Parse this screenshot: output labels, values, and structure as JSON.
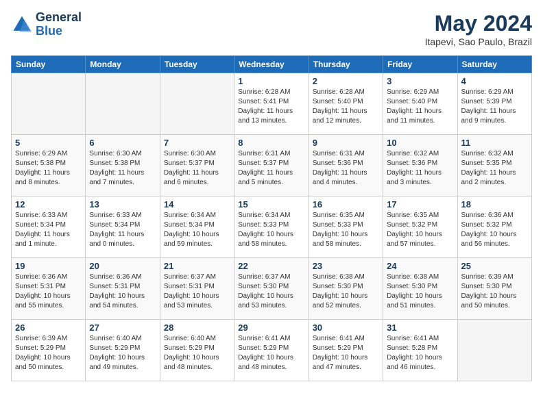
{
  "header": {
    "logo_line1": "General",
    "logo_line2": "Blue",
    "month": "May 2024",
    "location": "Itapevi, Sao Paulo, Brazil"
  },
  "days_of_week": [
    "Sunday",
    "Monday",
    "Tuesday",
    "Wednesday",
    "Thursday",
    "Friday",
    "Saturday"
  ],
  "weeks": [
    [
      {
        "day": "",
        "empty": true
      },
      {
        "day": "",
        "empty": true
      },
      {
        "day": "",
        "empty": true
      },
      {
        "day": "1",
        "sunrise": "6:28 AM",
        "sunset": "5:41 PM",
        "daylight": "11 hours and 13 minutes."
      },
      {
        "day": "2",
        "sunrise": "6:28 AM",
        "sunset": "5:40 PM",
        "daylight": "11 hours and 12 minutes."
      },
      {
        "day": "3",
        "sunrise": "6:29 AM",
        "sunset": "5:40 PM",
        "daylight": "11 hours and 11 minutes."
      },
      {
        "day": "4",
        "sunrise": "6:29 AM",
        "sunset": "5:39 PM",
        "daylight": "11 hours and 9 minutes."
      }
    ],
    [
      {
        "day": "5",
        "sunrise": "6:29 AM",
        "sunset": "5:38 PM",
        "daylight": "11 hours and 8 minutes."
      },
      {
        "day": "6",
        "sunrise": "6:30 AM",
        "sunset": "5:38 PM",
        "daylight": "11 hours and 7 minutes."
      },
      {
        "day": "7",
        "sunrise": "6:30 AM",
        "sunset": "5:37 PM",
        "daylight": "11 hours and 6 minutes."
      },
      {
        "day": "8",
        "sunrise": "6:31 AM",
        "sunset": "5:37 PM",
        "daylight": "11 hours and 5 minutes."
      },
      {
        "day": "9",
        "sunrise": "6:31 AM",
        "sunset": "5:36 PM",
        "daylight": "11 hours and 4 minutes."
      },
      {
        "day": "10",
        "sunrise": "6:32 AM",
        "sunset": "5:36 PM",
        "daylight": "11 hours and 3 minutes."
      },
      {
        "day": "11",
        "sunrise": "6:32 AM",
        "sunset": "5:35 PM",
        "daylight": "11 hours and 2 minutes."
      }
    ],
    [
      {
        "day": "12",
        "sunrise": "6:33 AM",
        "sunset": "5:34 PM",
        "daylight": "11 hours and 1 minute."
      },
      {
        "day": "13",
        "sunrise": "6:33 AM",
        "sunset": "5:34 PM",
        "daylight": "11 hours and 0 minutes."
      },
      {
        "day": "14",
        "sunrise": "6:34 AM",
        "sunset": "5:34 PM",
        "daylight": "10 hours and 59 minutes."
      },
      {
        "day": "15",
        "sunrise": "6:34 AM",
        "sunset": "5:33 PM",
        "daylight": "10 hours and 58 minutes."
      },
      {
        "day": "16",
        "sunrise": "6:35 AM",
        "sunset": "5:33 PM",
        "daylight": "10 hours and 58 minutes."
      },
      {
        "day": "17",
        "sunrise": "6:35 AM",
        "sunset": "5:32 PM",
        "daylight": "10 hours and 57 minutes."
      },
      {
        "day": "18",
        "sunrise": "6:36 AM",
        "sunset": "5:32 PM",
        "daylight": "10 hours and 56 minutes."
      }
    ],
    [
      {
        "day": "19",
        "sunrise": "6:36 AM",
        "sunset": "5:31 PM",
        "daylight": "10 hours and 55 minutes."
      },
      {
        "day": "20",
        "sunrise": "6:36 AM",
        "sunset": "5:31 PM",
        "daylight": "10 hours and 54 minutes."
      },
      {
        "day": "21",
        "sunrise": "6:37 AM",
        "sunset": "5:31 PM",
        "daylight": "10 hours and 53 minutes."
      },
      {
        "day": "22",
        "sunrise": "6:37 AM",
        "sunset": "5:30 PM",
        "daylight": "10 hours and 53 minutes."
      },
      {
        "day": "23",
        "sunrise": "6:38 AM",
        "sunset": "5:30 PM",
        "daylight": "10 hours and 52 minutes."
      },
      {
        "day": "24",
        "sunrise": "6:38 AM",
        "sunset": "5:30 PM",
        "daylight": "10 hours and 51 minutes."
      },
      {
        "day": "25",
        "sunrise": "6:39 AM",
        "sunset": "5:30 PM",
        "daylight": "10 hours and 50 minutes."
      }
    ],
    [
      {
        "day": "26",
        "sunrise": "6:39 AM",
        "sunset": "5:29 PM",
        "daylight": "10 hours and 50 minutes."
      },
      {
        "day": "27",
        "sunrise": "6:40 AM",
        "sunset": "5:29 PM",
        "daylight": "10 hours and 49 minutes."
      },
      {
        "day": "28",
        "sunrise": "6:40 AM",
        "sunset": "5:29 PM",
        "daylight": "10 hours and 48 minutes."
      },
      {
        "day": "29",
        "sunrise": "6:41 AM",
        "sunset": "5:29 PM",
        "daylight": "10 hours and 48 minutes."
      },
      {
        "day": "30",
        "sunrise": "6:41 AM",
        "sunset": "5:29 PM",
        "daylight": "10 hours and 47 minutes."
      },
      {
        "day": "31",
        "sunrise": "6:41 AM",
        "sunset": "5:28 PM",
        "daylight": "10 hours and 46 minutes."
      },
      {
        "day": "",
        "empty": true
      }
    ]
  ]
}
